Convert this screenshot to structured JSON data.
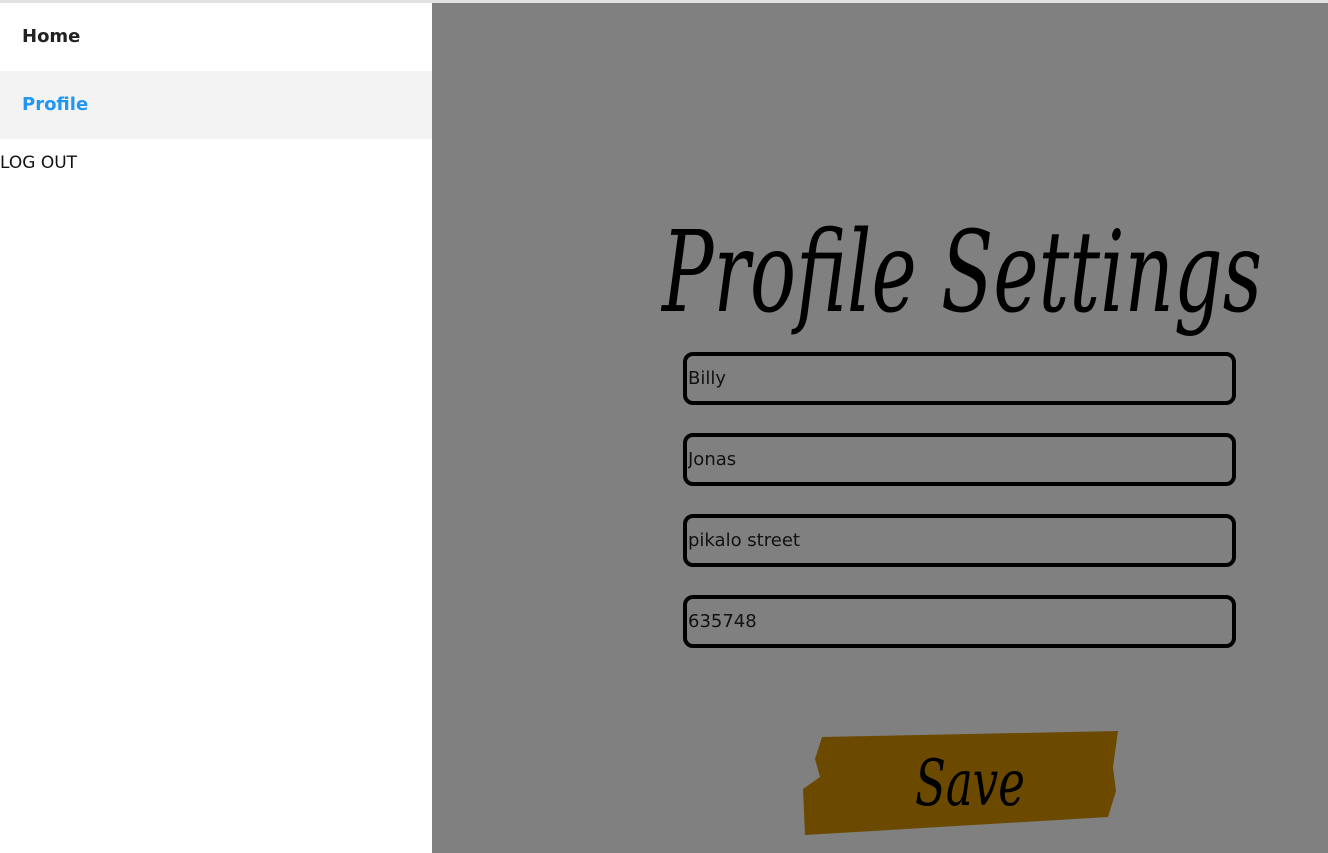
{
  "drawer": {
    "items": [
      {
        "label": "Home",
        "active": false
      },
      {
        "label": "Profile",
        "active": true
      }
    ],
    "logout_label": "LOG OUT"
  },
  "main": {
    "title": "Profile Settings",
    "fields": [
      {
        "value": "Billy"
      },
      {
        "value": "Jonas"
      },
      {
        "value": "pikalo street"
      },
      {
        "value": "635748"
      }
    ],
    "save_label": "Save"
  },
  "colors": {
    "accent": "#2196f3",
    "overlay": "#808080",
    "save_button": "#6b4a00"
  }
}
